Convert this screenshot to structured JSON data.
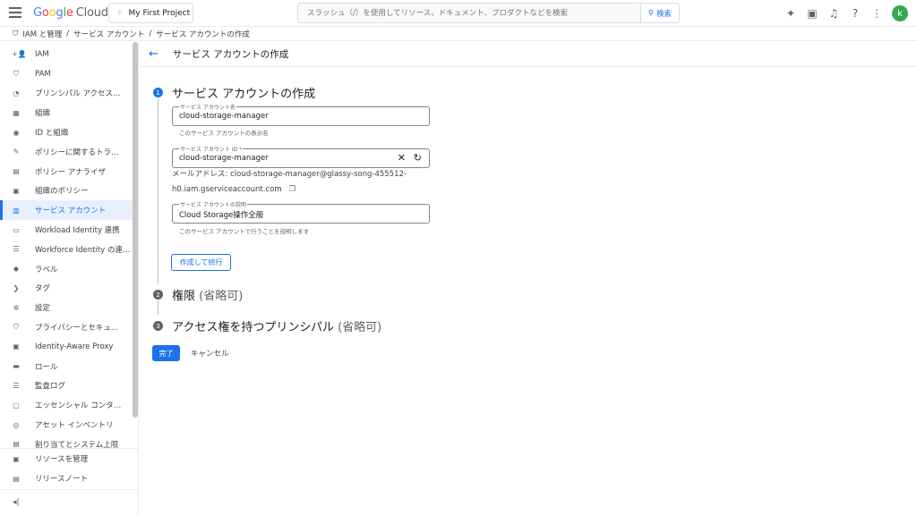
{
  "header": {
    "logo": {
      "g": "G",
      "o1": "o",
      "o2": "o",
      "g2": "g",
      "l": "l",
      "e": "e",
      "cloud": "Cloud"
    },
    "project": "My First Project",
    "search_placeholder": "スラッシュ（/）を使用してリソース、ドキュメント、プロダクトなどを検索",
    "search_button": "検索",
    "avatar_initial": "k"
  },
  "breadcrumb": [
    "IAM と管理",
    "/",
    "サービス アカウント",
    "/",
    "サービス アカウントの作成"
  ],
  "sidebar": {
    "items": [
      {
        "label": "IAM",
        "icon": "+👤"
      },
      {
        "label": "PAM",
        "icon": "⛉"
      },
      {
        "label": "プリンシパル アクセス…",
        "icon": "◔"
      },
      {
        "label": "組織",
        "icon": "▦"
      },
      {
        "label": "ID と組織",
        "icon": "◉"
      },
      {
        "label": "ポリシーに関するトラ…",
        "icon": "✎"
      },
      {
        "label": "ポリシー アナライザ",
        "icon": "▤"
      },
      {
        "label": "組織のポリシー",
        "icon": "▣"
      },
      {
        "label": "サービス アカウント",
        "icon": "▥"
      },
      {
        "label": "Workload Identity 連携",
        "icon": "▭"
      },
      {
        "label": "Workforce Identity の連…",
        "icon": "☰"
      },
      {
        "label": "ラベル",
        "icon": "◆"
      },
      {
        "label": "タグ",
        "icon": "❯"
      },
      {
        "label": "設定",
        "icon": "✲"
      },
      {
        "label": "プライバシーとセキュ…",
        "icon": "⛉"
      },
      {
        "label": "Identity-Aware Proxy",
        "icon": "▣"
      },
      {
        "label": "ロール",
        "icon": "▬"
      },
      {
        "label": "監査ログ",
        "icon": "☰"
      },
      {
        "label": "エッセンシャル コンタ…",
        "icon": "▢"
      },
      {
        "label": "アセット インベントリ",
        "icon": "◎"
      },
      {
        "label": "割り当てとシステム上限",
        "icon": "▤"
      }
    ],
    "active_index": 8,
    "bottom": [
      {
        "label": "リソースを管理",
        "icon": "▣"
      },
      {
        "label": "リリースノート",
        "icon": "▤"
      }
    ],
    "collapse_icon": "◂|"
  },
  "main": {
    "back_icon": "←",
    "title": "サービス アカウントの作成",
    "step1": {
      "num": "1",
      "title": "サービス アカウントの作成",
      "name_label": "サービス アカウント名",
      "name_value": "cloud-storage-manager",
      "name_hint": "このサービス アカウントの表示名",
      "id_label": "サービス アカウント ID *",
      "id_value": "cloud-storage-manager",
      "email_line1": "メールアドレス: cloud-storage-manager@glassy-song-455512-",
      "email_line2": "h0.iam.gserviceaccount.com",
      "desc_label": "サービス アカウントの説明",
      "desc_value": "Cloud Storage操作全般",
      "desc_hint": "このサービス アカウントで行うことを説明します",
      "continue_button": "作成して続行"
    },
    "step2": {
      "num": "2",
      "title": "権限",
      "optional": "(省略可)"
    },
    "step3": {
      "num": "3",
      "title": "アクセス権を持つプリンシパル",
      "optional": "(省略可)"
    },
    "done_button": "完了",
    "cancel_button": "キャンセル"
  },
  "colors": {
    "accent": "#1a73e8",
    "active_bg": "#e8f0fe",
    "avatar": "#34a853"
  }
}
